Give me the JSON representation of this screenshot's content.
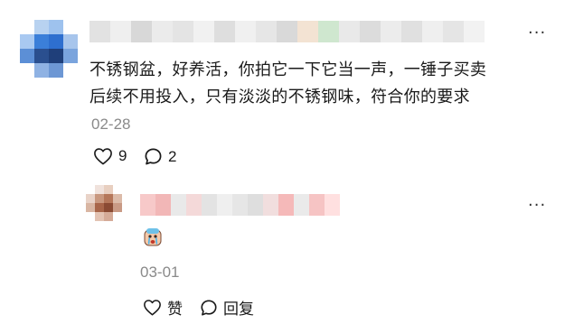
{
  "comment": {
    "text": "不锈钢盆，好养活，你拍它一下它当一声，一锤子买卖后续不用投入，只有淡淡的不锈钢味，符合你的要求",
    "line1": "不锈钢盆，好养活，你拍它一下它当一声，一锤子买卖",
    "line2": "后续不用投入，只有淡淡的不锈钢味，符合你的要求",
    "date": "02-28",
    "like_count": "9",
    "comment_count": "2",
    "more_icon": "ellipsis-icon"
  },
  "reply": {
    "emoji": "crying-face-emoji",
    "date": "03-01",
    "like_label": "赞",
    "reply_label": "回复",
    "more_icon": "ellipsis-icon"
  },
  "colors": {
    "text": "#1a1a1a",
    "meta": "#8a8a8a",
    "icon": "#333333"
  }
}
